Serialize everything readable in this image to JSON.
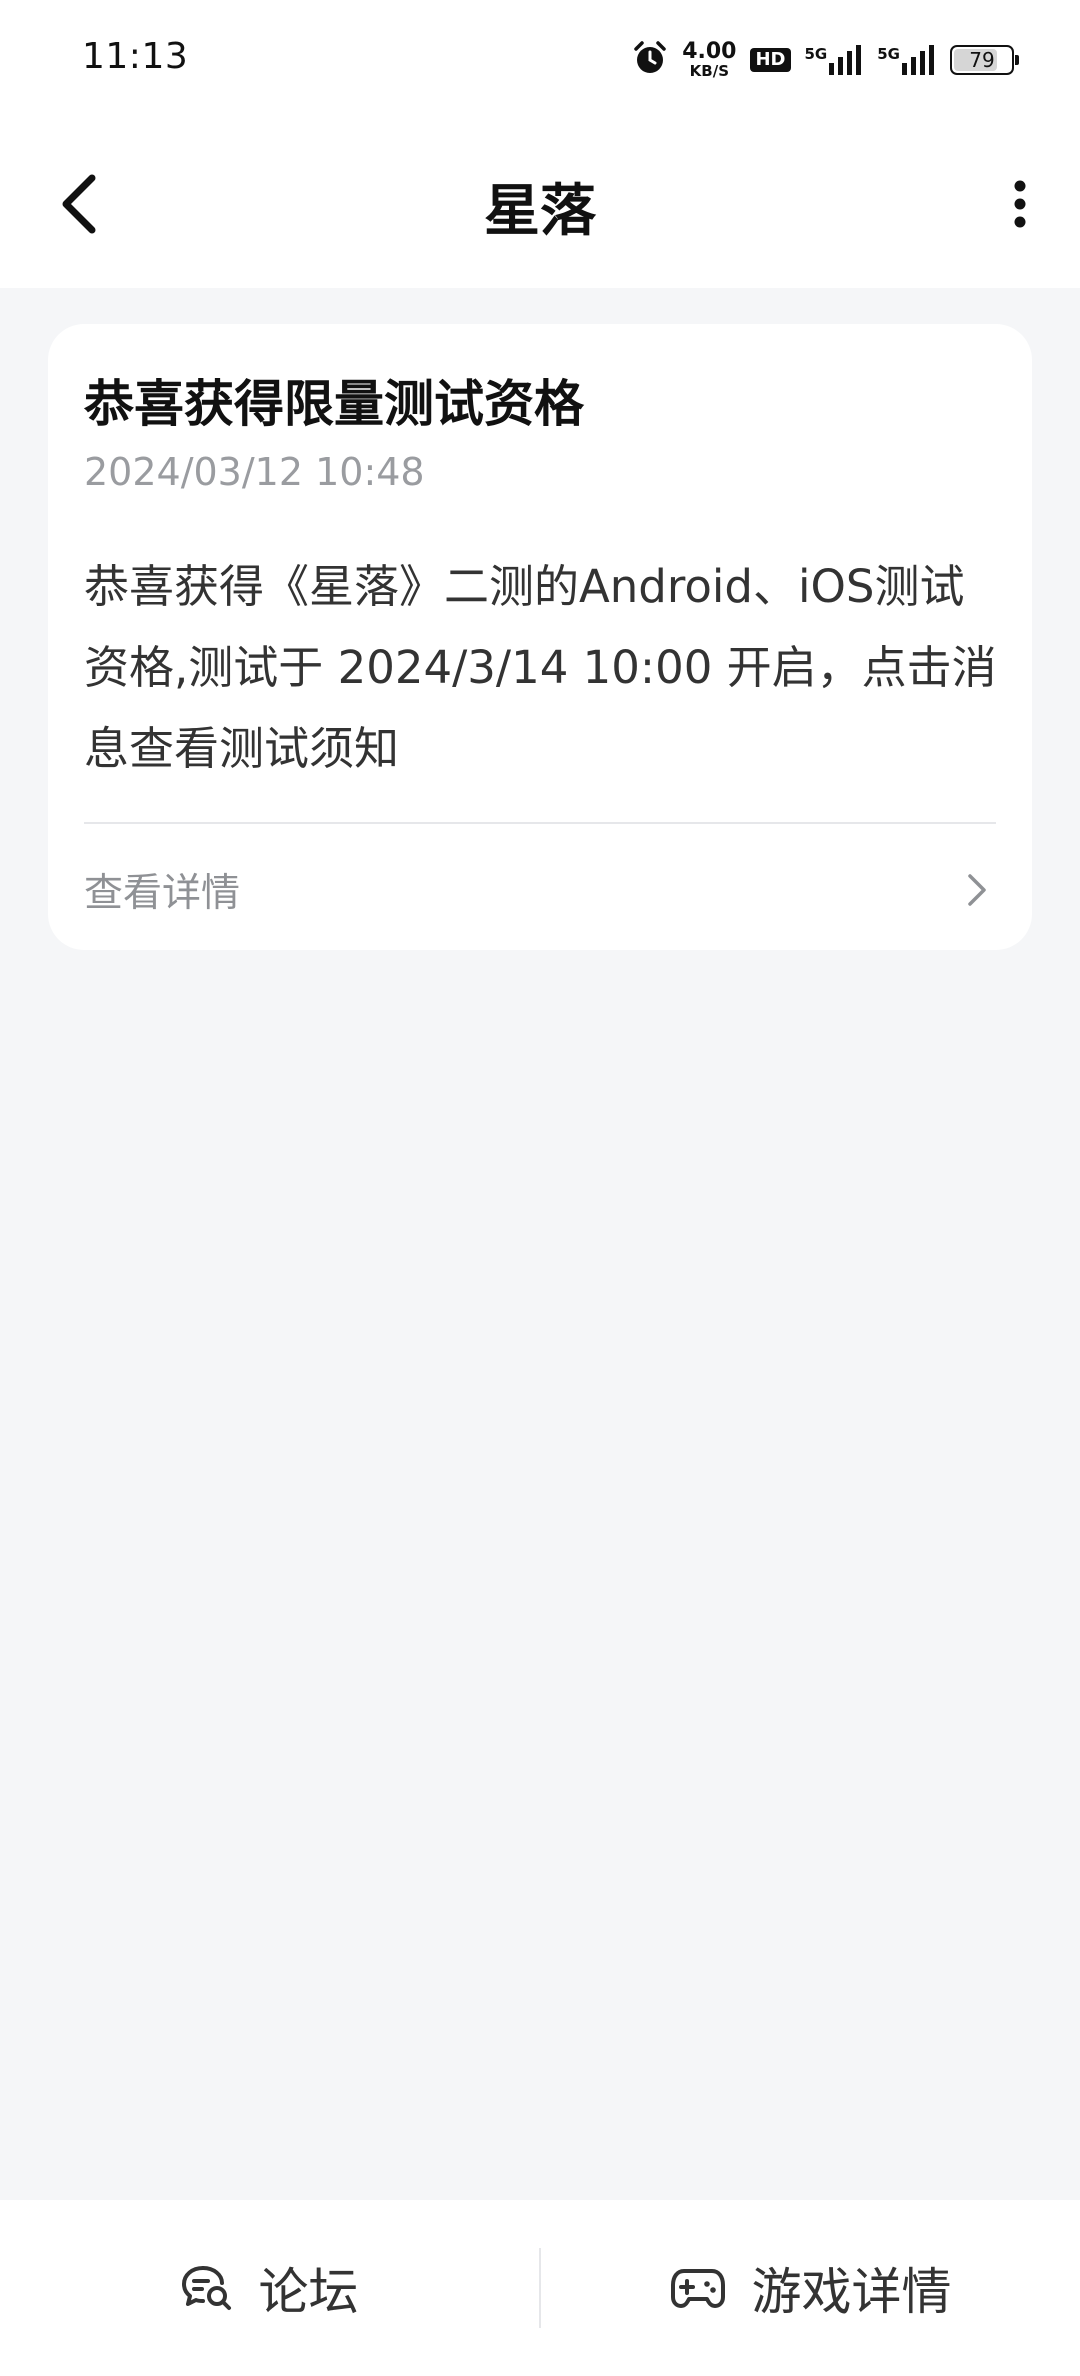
{
  "status_bar": {
    "time": "11:13",
    "net_speed_value": "4.00",
    "net_speed_unit": "KB/S",
    "hd_label": "HD",
    "signal1_label": "5G",
    "signal2_label": "5G",
    "battery_level": "79"
  },
  "nav": {
    "title": "星落",
    "back_icon": "chevron-left-icon",
    "more_icon": "more-vertical-icon"
  },
  "message": {
    "title": "恭喜获得限量测试资格",
    "time": "2024/03/12 10:48",
    "body": "恭喜获得《星落》二测的Android、iOS测试资格,测试于 2024/3/14 10:00 开启，点击消息查看测试须知",
    "link_label": "查看详情"
  },
  "bottom_bar": {
    "forum_label": "论坛",
    "game_detail_label": "游戏详情",
    "forum_icon": "chat-search-icon",
    "game_icon": "gamepad-icon"
  },
  "colors": {
    "page_background": "#f5f6f8",
    "card_background": "#ffffff",
    "title_text": "#111111",
    "muted_text": "#9a9ca0"
  }
}
